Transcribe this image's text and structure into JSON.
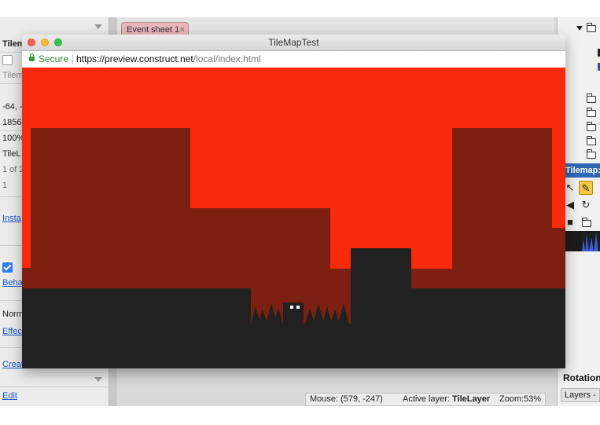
{
  "editor": {
    "left_panel": {
      "title": "Tilem",
      "field_1": "Tilem",
      "position": "-64, -",
      "size": "1856",
      "opacity": "100%",
      "layer": "TileL",
      "count": "1 of 2",
      "value": "1",
      "instance_link": "Insta",
      "behaviors_link": "Beha",
      "blend": "Norm",
      "effects_link": "Effec",
      "create_link": "Creat",
      "edit_link": "Edit"
    },
    "tab": {
      "label": "Event sheet 1",
      "close": "×"
    },
    "right_panel": {
      "tilemap_bar": "Tilemap: T",
      "rotation_label": "Rotation",
      "layers_label": "Layers - "
    },
    "status": {
      "mouse_label": "Mouse:",
      "mouse_value": "(579, -247)",
      "layer_label": "Active layer:",
      "layer_value": "TileLayer",
      "zoom_label": "Zoom:",
      "zoom_value": "53%"
    }
  },
  "browser": {
    "title": "TileMapTest",
    "secure_label": "Secure",
    "url_host": "https://preview.construct.net",
    "url_path": "/local/index.html"
  },
  "colors": {
    "sky": "#f82a09",
    "hills": "#7e2011",
    "ground": "#212121",
    "player_eyes": "#ffffff"
  }
}
